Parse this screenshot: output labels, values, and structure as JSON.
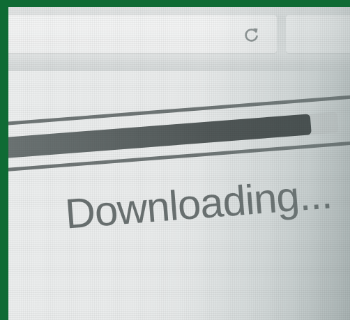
{
  "toolbar": {
    "address_bar": {
      "value": ""
    },
    "reload_icon": "reload-icon",
    "search_bar": {
      "value": ""
    }
  },
  "download": {
    "progress": 0.92,
    "status_text": "Downloading..."
  },
  "colors": {
    "frame": "#0f6b34",
    "screen": "#e9ebeb",
    "progress_fill": "#555c5c",
    "text": "#6a7171"
  }
}
